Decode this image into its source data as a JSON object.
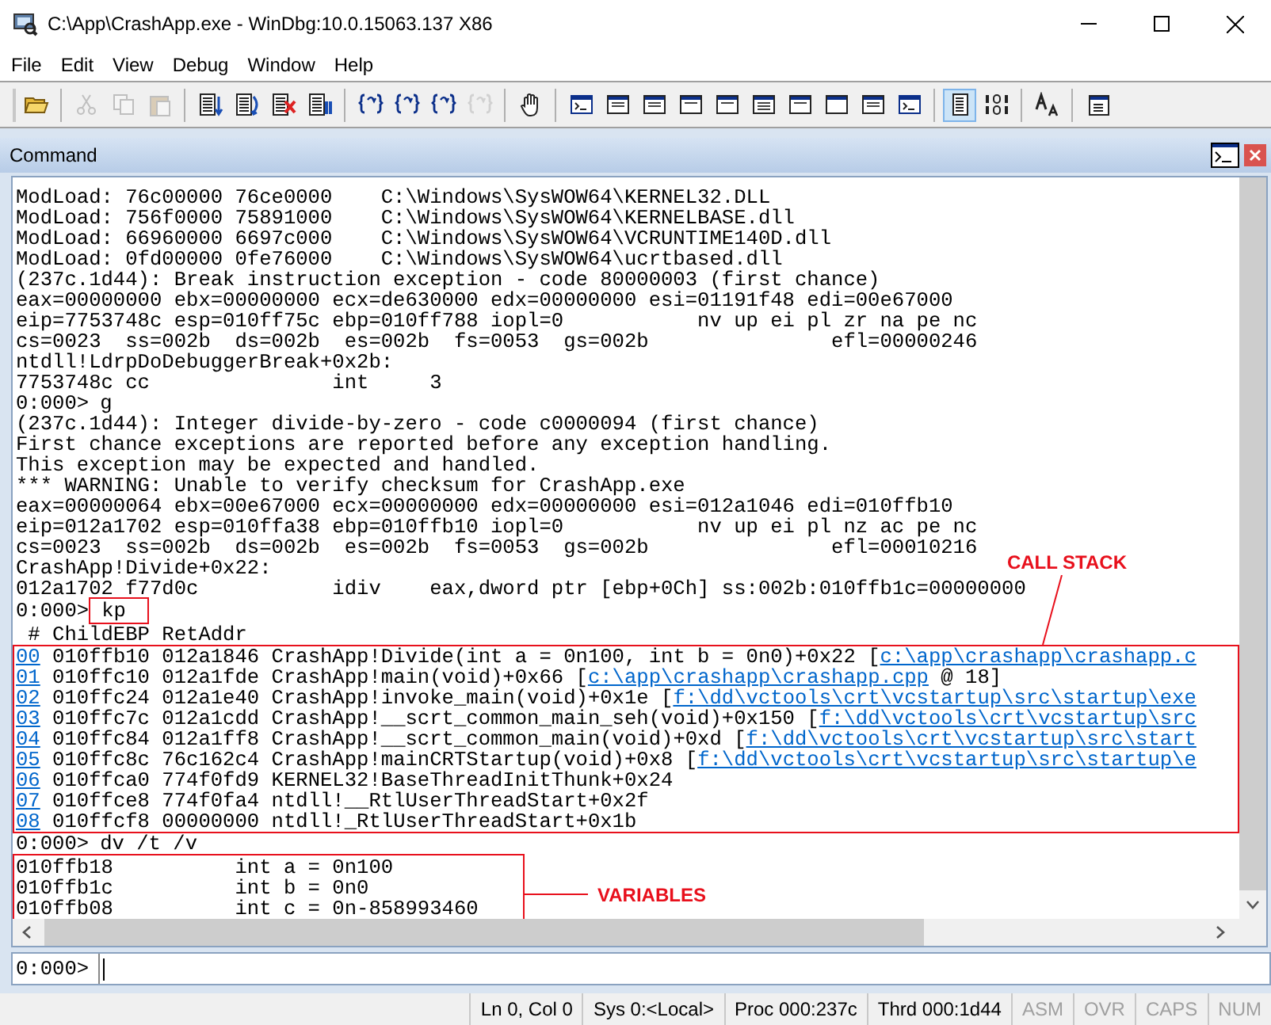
{
  "window": {
    "title": "C:\\App\\CrashApp.exe - WinDbg:10.0.15063.137 X86"
  },
  "menu": [
    "File",
    "Edit",
    "View",
    "Debug",
    "Window",
    "Help"
  ],
  "toolbar": [
    {
      "buttons": [
        {
          "kind": "folder",
          "disabled": false,
          "pressed": false
        }
      ]
    },
    {
      "buttons": [
        {
          "kind": "scissors",
          "disabled": true,
          "pressed": false
        },
        {
          "kind": "copy",
          "disabled": true,
          "pressed": false
        },
        {
          "kind": "paste",
          "disabled": true,
          "pressed": false
        }
      ]
    },
    {
      "buttons": [
        {
          "kind": "doc-arrow",
          "disabled": false,
          "pressed": false
        },
        {
          "kind": "doc-cycle",
          "disabled": false,
          "pressed": false
        },
        {
          "kind": "doc-cross",
          "disabled": false,
          "pressed": false
        },
        {
          "kind": "doc-bars",
          "disabled": false,
          "pressed": false
        }
      ]
    },
    {
      "buttons": [
        {
          "kind": "braces-in",
          "disabled": false,
          "pressed": false
        },
        {
          "kind": "braces-over",
          "disabled": false,
          "pressed": false
        },
        {
          "kind": "braces-out",
          "disabled": false,
          "pressed": false
        },
        {
          "kind": "braces-cursor",
          "disabled": true,
          "pressed": false
        }
      ]
    },
    {
      "buttons": [
        {
          "kind": "hand",
          "disabled": false,
          "pressed": false
        }
      ]
    },
    {
      "buttons": [
        {
          "kind": "console-window",
          "disabled": false,
          "pressed": false
        },
        {
          "kind": "watch-window",
          "disabled": false,
          "pressed": false
        },
        {
          "kind": "locals-window",
          "disabled": false,
          "pressed": false
        },
        {
          "kind": "registers-window",
          "disabled": false,
          "pressed": false
        },
        {
          "kind": "memory-window",
          "disabled": false,
          "pressed": false
        },
        {
          "kind": "stack-window",
          "disabled": false,
          "pressed": false
        },
        {
          "kind": "disasm-window",
          "disabled": false,
          "pressed": false
        },
        {
          "kind": "blank-window",
          "disabled": false,
          "pressed": false
        },
        {
          "kind": "list-window",
          "disabled": false,
          "pressed": false
        },
        {
          "kind": "console-window",
          "disabled": false,
          "pressed": false
        }
      ]
    },
    {
      "buttons": [
        {
          "kind": "source-mode",
          "disabled": false,
          "pressed": true
        },
        {
          "kind": "binary",
          "disabled": false,
          "pressed": false
        }
      ]
    },
    {
      "buttons": [
        {
          "kind": "font",
          "disabled": false,
          "pressed": false
        }
      ]
    },
    {
      "buttons": [
        {
          "kind": "properties",
          "disabled": false,
          "pressed": false
        }
      ]
    }
  ],
  "pane": {
    "title": "Command"
  },
  "output": [
    {
      "kind": "text",
      "text": "ModLoad: 76c00000 76ce0000    C:\\Windows\\SysWOW64\\KERNEL32.DLL"
    },
    {
      "kind": "text",
      "text": "ModLoad: 756f0000 75891000    C:\\Windows\\SysWOW64\\KERNELBASE.dll"
    },
    {
      "kind": "text",
      "text": "ModLoad: 66960000 6697c000    C:\\Windows\\SysWOW64\\VCRUNTIME140D.dll"
    },
    {
      "kind": "text",
      "text": "ModLoad: 0fd00000 0fe76000    C:\\Windows\\SysWOW64\\ucrtbased.dll"
    },
    {
      "kind": "text",
      "text": "(237c.1d44): Break instruction exception - code 80000003 (first chance)"
    },
    {
      "kind": "text",
      "text": "eax=00000000 ebx=00000000 ecx=de630000 edx=00000000 esi=01191f48 edi=00e67000"
    },
    {
      "kind": "text",
      "text": "eip=7753748c esp=010ff75c ebp=010ff788 iopl=0           nv up ei pl zr na pe nc"
    },
    {
      "kind": "text",
      "text": "cs=0023  ss=002b  ds=002b  es=002b  fs=0053  gs=002b               efl=00000246"
    },
    {
      "kind": "text",
      "text": "ntdll!LdrpDoDebuggerBreak+0x2b:"
    },
    {
      "kind": "text",
      "text": "7753748c cc               int     3"
    },
    {
      "kind": "prompt",
      "prompt": "0:000>",
      "command": "g",
      "boxed": false
    },
    {
      "kind": "text",
      "text": "(237c.1d44): Integer divide-by-zero - code c0000094 (first chance)"
    },
    {
      "kind": "text",
      "text": "First chance exceptions are reported before any exception handling."
    },
    {
      "kind": "text",
      "text": "This exception may be expected and handled."
    },
    {
      "kind": "text",
      "text": "*** WARNING: Unable to verify checksum for CrashApp.exe"
    },
    {
      "kind": "text",
      "text": "eax=00000064 ebx=00e67000 ecx=00000000 edx=00000000 esi=012a1046 edi=010ffb10"
    },
    {
      "kind": "text",
      "text": "eip=012a1702 esp=010ffa38 ebp=010ffb10 iopl=0           nv up ei pl nz ac pe nc"
    },
    {
      "kind": "text",
      "text": "cs=0023  ss=002b  ds=002b  es=002b  fs=0053  gs=002b               efl=00010216"
    },
    {
      "kind": "text",
      "text": "CrashApp!Divide+0x22:"
    },
    {
      "kind": "text",
      "text": "012a1702 f77d0c           idiv    eax,dword ptr [ebp+0Ch] ss:002b:010ffb1c=00000000"
    },
    {
      "kind": "prompt",
      "prompt": "0:000>",
      "command": "kp",
      "boxed": true
    },
    {
      "kind": "text",
      "text": " # ChildEBP RetAddr"
    },
    {
      "kind": "callstack",
      "label": "CALL STACK",
      "frames": [
        {
          "num": "00",
          "text": "010ffb10 012a1846 CrashApp!Divide(int a = 0n100, int b = 0n0)+0x22 [",
          "link": "c:\\app\\crashapp\\crashapp.c"
        },
        {
          "num": "01",
          "text": "010ffc10 012a1fde CrashApp!main(void)+0x66 [",
          "link": "c:\\app\\crashapp\\crashapp.cpp",
          "after": " @ 18]"
        },
        {
          "num": "02",
          "text": "010ffc24 012a1e40 CrashApp!invoke_main(void)+0x1e [",
          "link": "f:\\dd\\vctools\\crt\\vcstartup\\src\\startup\\exe"
        },
        {
          "num": "03",
          "text": "010ffc7c 012a1cdd CrashApp!__scrt_common_main_seh(void)+0x150 [",
          "link": "f:\\dd\\vctools\\crt\\vcstartup\\src"
        },
        {
          "num": "04",
          "text": "010ffc84 012a1ff8 CrashApp!__scrt_common_main(void)+0xd [",
          "link": "f:\\dd\\vctools\\crt\\vcstartup\\src\\start"
        },
        {
          "num": "05",
          "text": "010ffc8c 76c162c4 CrashApp!mainCRTStartup(void)+0x8 [",
          "link": "f:\\dd\\vctools\\crt\\vcstartup\\src\\startup\\e"
        },
        {
          "num": "06",
          "text": "010ffca0 774f0fd9 KERNEL32!BaseThreadInitThunk+0x24"
        },
        {
          "num": "07",
          "text": "010ffce8 774f0fa4 ntdll!__RtlUserThreadStart+0x2f"
        },
        {
          "num": "08",
          "text": "010ffcf8 00000000 ntdll!_RtlUserThreadStart+0x1b"
        }
      ]
    },
    {
      "kind": "prompt",
      "prompt": "0:000>",
      "command": "dv /t /v",
      "boxed": false
    },
    {
      "kind": "variables",
      "label": "VARIABLES",
      "lines": [
        "010ffb18          int a = 0n100",
        "010ffb1c          int b = 0n0",
        "010ffb08          int c = 0n-858993460"
      ]
    }
  ],
  "input": {
    "prompt": "0:000>"
  },
  "status_bar": [
    {
      "text": "Ln 0, Col 0",
      "disabled": false
    },
    {
      "text": "Sys 0:<Local>",
      "disabled": false
    },
    {
      "text": "Proc 000:237c",
      "disabled": false
    },
    {
      "text": "Thrd 000:1d44",
      "disabled": false
    },
    {
      "text": "ASM",
      "disabled": true
    },
    {
      "text": "OVR",
      "disabled": true
    },
    {
      "text": "CAPS",
      "disabled": true
    },
    {
      "text": "NUM",
      "disabled": true
    }
  ]
}
